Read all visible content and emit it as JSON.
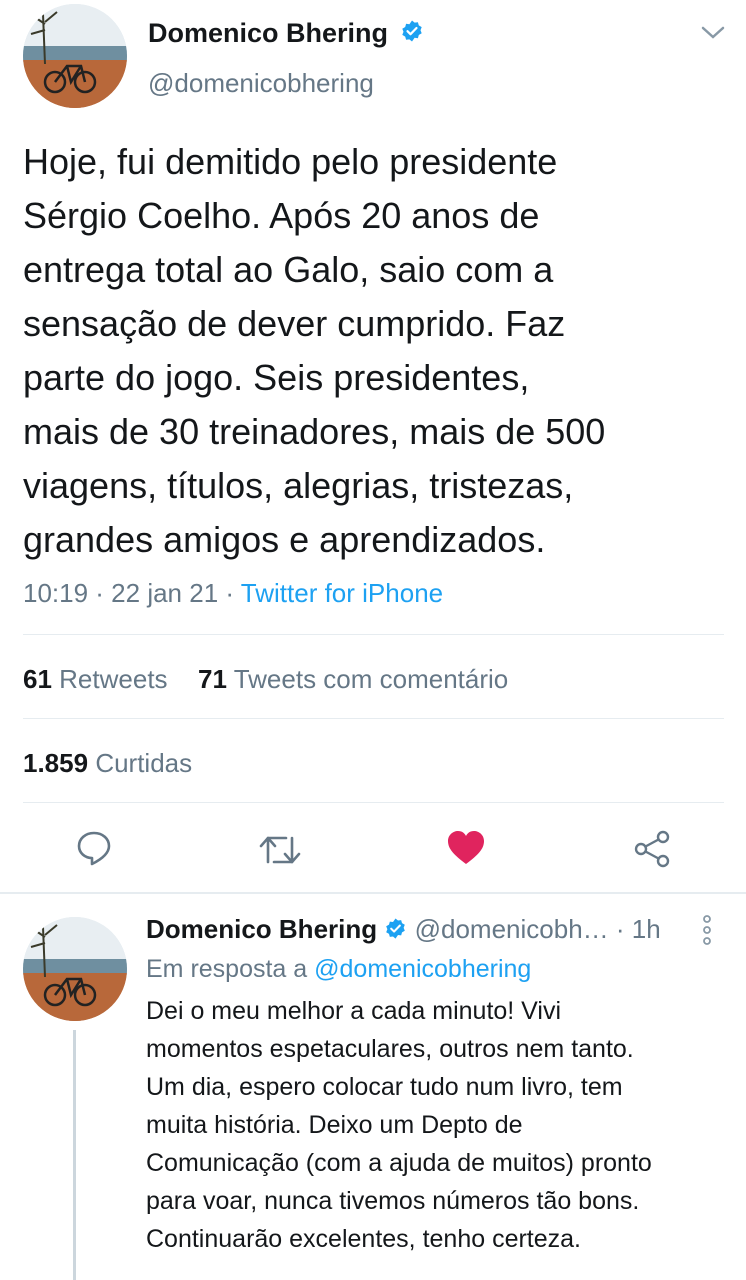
{
  "tweet": {
    "author_name": "Domenico Bhering",
    "author_handle": "@domenicobhering",
    "text_lines": [
      "Hoje, fui demitido pelo presidente",
      "Sérgio Coelho. Após 20 anos de",
      "entrega total ao Galo, saio com a",
      "sensação de dever cumprido. Faz",
      "parte do jogo. Seis presidentes,",
      "mais de 30 treinadores, mais de 500",
      "viagens, títulos, alegrias, tristezas,",
      "grandes amigos e aprendizados."
    ],
    "time": "10:19 · 22 jan 21 · ",
    "source": "Twitter for iPhone",
    "retweets_count": "61",
    "retweets_label": "Retweets",
    "quotes_count": "71",
    "quotes_label": "Tweets com comentário",
    "likes_count": "1.859",
    "likes_label": "Curtidas"
  },
  "reply": {
    "author_name": "Domenico Bhering",
    "author_handle": "@domenicobh…",
    "age": "· 1h",
    "reply_to_label": "Em resposta a ",
    "reply_to_mention": "@domenicobhering",
    "text_lines": [
      "Dei o meu melhor a cada minuto! Vivi",
      "momentos espetaculares, outros nem tanto.",
      "Um dia, espero colocar tudo num livro, tem",
      "muita história. Deixo um Depto de",
      "Comunicação (com a ajuda de muitos) pronto",
      "para voar, nunca tivemos números tão bons.",
      "Continuarão excelentes, tenho certeza."
    ]
  },
  "icons": {
    "verified": "verified-badge-icon",
    "menu": "chevron-down-icon",
    "reply": "reply-icon",
    "retweet": "retweet-icon",
    "like": "heart-icon",
    "share": "share-icon",
    "more": "more-vertical-icon"
  },
  "colors": {
    "accent": "#1da1f2",
    "like": "#e0245e",
    "secondary_text": "#657786",
    "divider": "#e6ecf0"
  }
}
